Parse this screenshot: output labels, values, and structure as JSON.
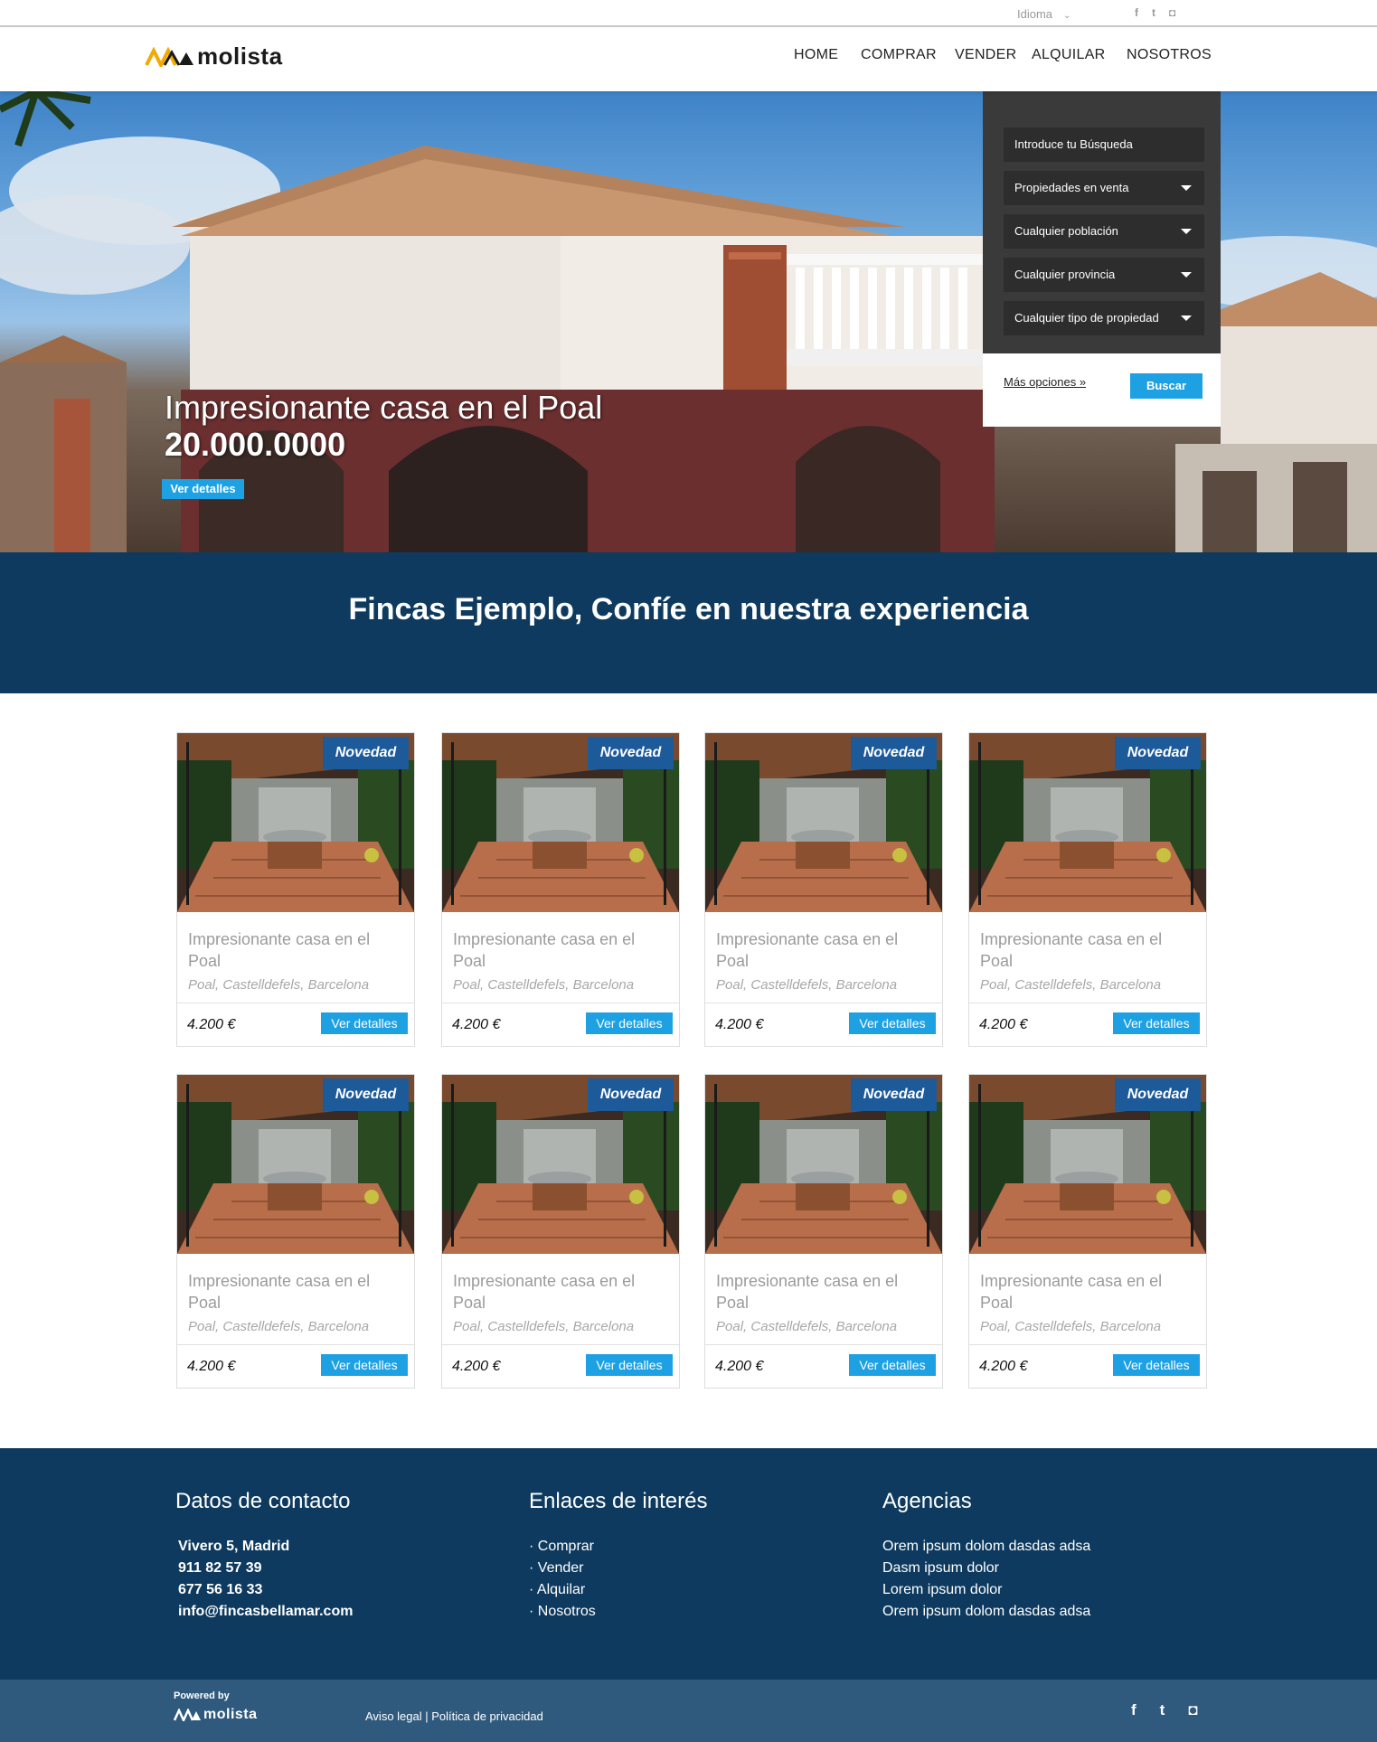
{
  "topbar": {
    "language_label": "Idioma",
    "social": [
      "f",
      "t",
      "ig"
    ]
  },
  "header": {
    "brand": "molista",
    "nav": [
      {
        "label": "HOME"
      },
      {
        "label": "COMPRAR"
      },
      {
        "label": "VENDER"
      },
      {
        "label": "ALQUILAR"
      },
      {
        "label": "NOSOTROS"
      }
    ]
  },
  "hero": {
    "title": "Impresionante casa en el Poal",
    "price": "20.000.0000",
    "button": "Ver detalles"
  },
  "search": {
    "placeholder": "Introduce tu Búsqueda",
    "selects": [
      "Propiedades en venta",
      "Cualquier población",
      "Cualquier provincia",
      "Cualquier tipo de propiedad"
    ],
    "more_options": "Más opciones »",
    "submit": "Buscar"
  },
  "banner": {
    "title": "Fincas Ejemplo, Confíe en nuestra experiencia"
  },
  "listings": [
    {
      "badge": "Novedad",
      "title": "Impresionante casa en el Poal",
      "location": "Poal, Castelldefels, Barcelona",
      "price": "4.200 €",
      "button": "Ver detalles"
    },
    {
      "badge": "Novedad",
      "title": "Impresionante casa en el Poal",
      "location": "Poal, Castelldefels, Barcelona",
      "price": "4.200 €",
      "button": "Ver detalles"
    },
    {
      "badge": "Novedad",
      "title": "Impresionante casa en el Poal",
      "location": "Poal, Castelldefels, Barcelona",
      "price": "4.200 €",
      "button": "Ver detalles"
    },
    {
      "badge": "Novedad",
      "title": "Impresionante casa en el Poal",
      "location": "Poal, Castelldefels, Barcelona",
      "price": "4.200 €",
      "button": "Ver detalles"
    },
    {
      "badge": "Novedad",
      "title": "Impresionante casa en el Poal",
      "location": "Poal, Castelldefels, Barcelona",
      "price": "4.200 €",
      "button": "Ver detalles"
    },
    {
      "badge": "Novedad",
      "title": "Impresionante casa en el Poal",
      "location": "Poal, Castelldefels, Barcelona",
      "price": "4.200 €",
      "button": "Ver detalles"
    },
    {
      "badge": "Novedad",
      "title": "Impresionante casa en el Poal",
      "location": "Poal, Castelldefels, Barcelona",
      "price": "4.200 €",
      "button": "Ver detalles"
    },
    {
      "badge": "Novedad",
      "title": "Impresionante casa en el Poal",
      "location": "Poal, Castelldefels, Barcelona",
      "price": "4.200 €",
      "button": "Ver detalles"
    }
  ],
  "footer": {
    "contact": {
      "heading": "Datos de contacto",
      "address": "Vivero 5, Madrid",
      "phone1": "911 82 57 39",
      "phone2": "677 56 16 33",
      "email": "info@fincasbellamar.com"
    },
    "links": {
      "heading": "Enlaces de interés",
      "items": [
        "· Comprar",
        "· Vender",
        "· Alquilar",
        "· Nosotros"
      ]
    },
    "agencies": {
      "heading": "Agencias",
      "items": [
        "Orem ipsum dolom dasdas adsa",
        "Dasm ipsum dolor",
        "Lorem ipsum dolor",
        "Orem ipsum dolom dasdas adsa"
      ]
    }
  },
  "bottom": {
    "powered_by": "Powered by",
    "brand": "molista",
    "legal": "Aviso legal | Política de privacidad",
    "social": [
      "f",
      "t",
      "ig"
    ]
  },
  "colors": {
    "accent": "#1da1e2",
    "navy": "#0d3a5e",
    "badge": "#1d5a9a",
    "search_panel": "#3a3a3a"
  }
}
